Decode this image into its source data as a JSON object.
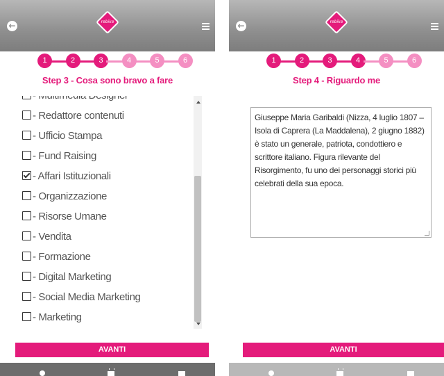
{
  "app": {
    "logo_text": "rebike"
  },
  "left_screen": {
    "steps": [
      "1",
      "2",
      "3",
      "4",
      "5",
      "6"
    ],
    "current_step": 3,
    "step_title": "Step 3 - Cosa sono bravo a fare",
    "options": [
      {
        "label": "- Multimedia Designer",
        "checked": false
      },
      {
        "label": "- Redattore contenuti",
        "checked": false
      },
      {
        "label": "- Ufficio Stampa",
        "checked": false
      },
      {
        "label": "- Fund Raising",
        "checked": false
      },
      {
        "label": "- Affari Istituzionali",
        "checked": true
      },
      {
        "label": "- Organizzazione",
        "checked": false
      },
      {
        "label": "- Risorse Umane",
        "checked": false
      },
      {
        "label": "- Vendita",
        "checked": false
      },
      {
        "label": "- Formazione",
        "checked": false
      },
      {
        "label": "- Digital Marketing",
        "checked": false
      },
      {
        "label": "- Social Media Marketing",
        "checked": false
      },
      {
        "label": "- Marketing",
        "checked": false
      }
    ],
    "next_label": "AVANTI"
  },
  "right_screen": {
    "steps": [
      "1",
      "2",
      "3",
      "4",
      "5",
      "6"
    ],
    "current_step": 4,
    "step_title": "Step 4 - Riguardo me",
    "about_text": "Giuseppe Maria Garibaldi (Nizza, 4 luglio 1807 – Isola di Caprera (La Maddalena), 2 giugno 1882) è stato un generale, patriota, condottiero e scrittore italiano. Figura rilevante del Risorgimento, fu uno dei personaggi storici più celebrati della sua epoca.",
    "next_label": "AVANTI"
  },
  "colors": {
    "accent": "#e41b7b",
    "accent_light": "#f48fc2",
    "bottom_bar_left": "#6d6d6d",
    "bottom_bar_right": "#b8b8b8"
  },
  "icons": {
    "back": "arrow-left-circle-icon",
    "menu": "hamburger-menu-icon",
    "tabs": [
      "user-icon",
      "calendar-icon",
      "mail-icon"
    ]
  }
}
